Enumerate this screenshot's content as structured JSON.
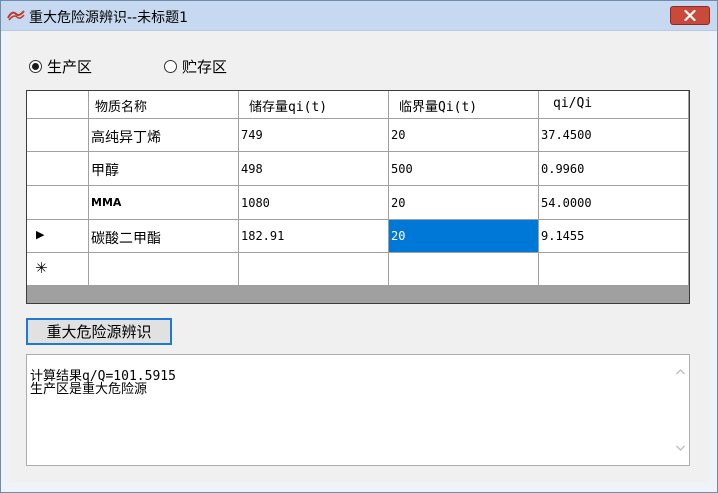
{
  "window": {
    "title": "重大危险源辨识--未标题1"
  },
  "radios": [
    {
      "label": "生产区",
      "checked": true
    },
    {
      "label": "贮存区",
      "checked": false
    }
  ],
  "grid": {
    "columns": [
      "物质名称",
      "储存量qi(t)",
      "临界量Qi(t)",
      "qi/Qi"
    ],
    "rows": [
      {
        "indicator": "",
        "cells": [
          "高纯异丁烯",
          "749",
          "20",
          "37.4500"
        ]
      },
      {
        "indicator": "",
        "cells": [
          "甲醇",
          "498",
          "500",
          "0.9960"
        ]
      },
      {
        "indicator": "",
        "cells": [
          "MMA",
          "1080",
          "20",
          "54.0000"
        ]
      },
      {
        "indicator": "▶",
        "cells": [
          "碳酸二甲酯",
          "182.91",
          "20",
          "9.1455"
        ]
      },
      {
        "indicator": "✳",
        "cells": [
          "",
          "",
          "",
          ""
        ]
      }
    ],
    "selected_cell": {
      "row": 3,
      "col": 2
    }
  },
  "identify_button": {
    "label": "重大危险源辨识"
  },
  "result": {
    "lines": [
      "计算结果q/Q=101.5915",
      "生产区是重大危险源"
    ]
  },
  "icons": {
    "app": "app-logo-icon",
    "close": "close-icon",
    "scroll_up": "scroll-up-icon",
    "scroll_down": "scroll-down-icon"
  },
  "colors": {
    "title_bar": "#c7d9f0",
    "close_button": "#c94a3b",
    "selection": "#0078d7",
    "button_border": "#1e78d6"
  }
}
